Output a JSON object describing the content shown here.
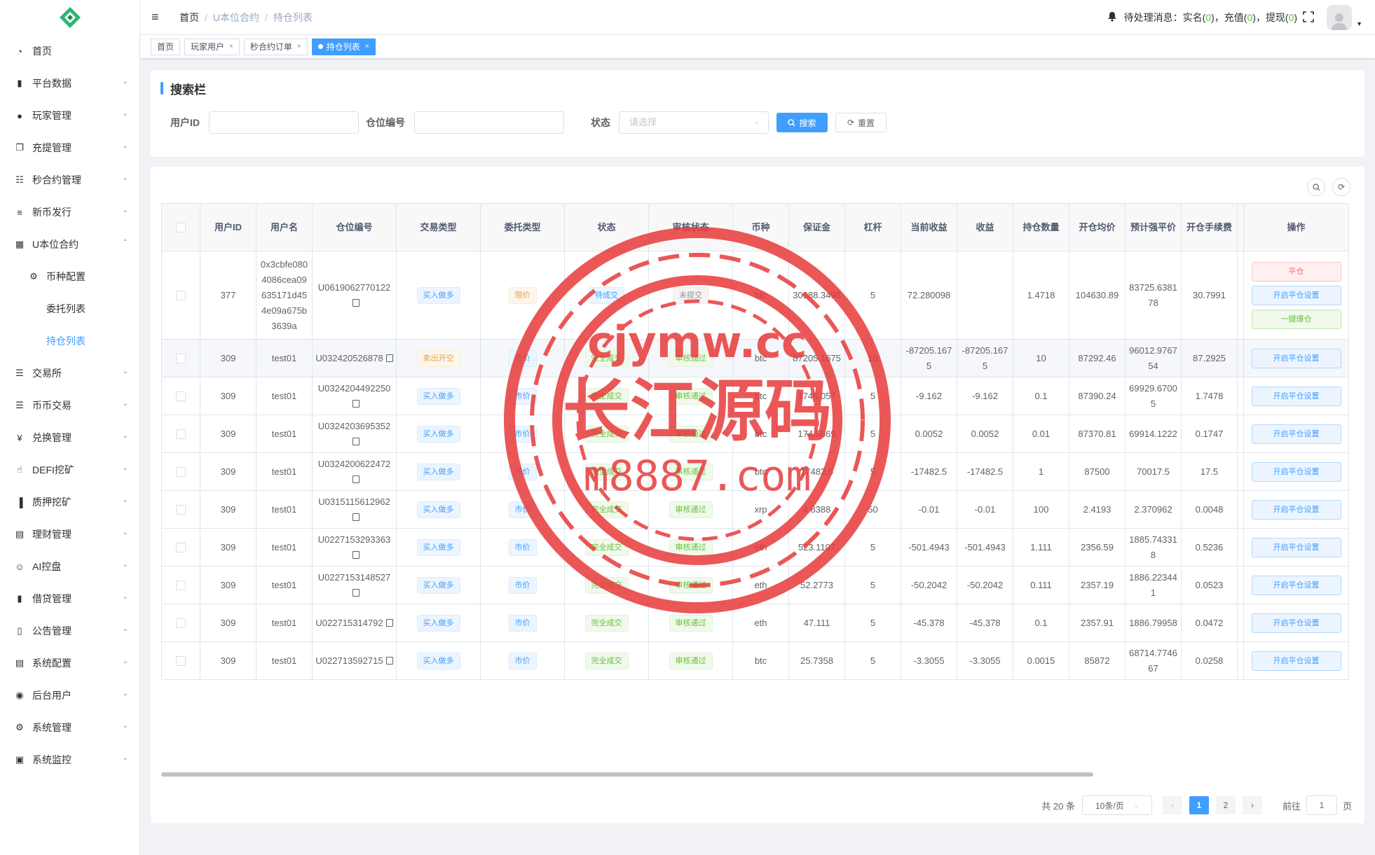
{
  "sidebar": {
    "items": [
      {
        "label": "首页",
        "icon": "dashboard-icon"
      },
      {
        "label": "平台数据",
        "icon": "book-icon",
        "arrow": "down"
      },
      {
        "label": "玩家管理",
        "icon": "user-icon",
        "arrow": "down"
      },
      {
        "label": "充提管理",
        "icon": "copy-icon",
        "arrow": "down"
      },
      {
        "label": "秒合约管理",
        "icon": "chart-icon",
        "arrow": "down"
      },
      {
        "label": "新币发行",
        "icon": "coin-icon",
        "arrow": "down"
      },
      {
        "label": "U本位合约",
        "icon": "grid-icon",
        "arrow": "up"
      },
      {
        "label": "币种配置",
        "icon": "gear-icon",
        "sub": true
      },
      {
        "label": "委托列表",
        "sub2": true
      },
      {
        "label": "持仓列表",
        "sub2": true,
        "active": true
      },
      {
        "label": "交易所",
        "icon": "list-icon",
        "arrow": "down"
      },
      {
        "label": "币币交易",
        "icon": "list-icon",
        "arrow": "down"
      },
      {
        "label": "兑换管理",
        "icon": "yen-icon",
        "arrow": "down"
      },
      {
        "label": "DEFI挖矿",
        "icon": "hand-icon",
        "arrow": "down"
      },
      {
        "label": "质押挖矿",
        "icon": "bar-chart-icon",
        "arrow": "down"
      },
      {
        "label": "理财管理",
        "icon": "document-icon",
        "arrow": "down"
      },
      {
        "label": "AI控盘",
        "icon": "robot-icon",
        "arrow": "down"
      },
      {
        "label": "借贷管理",
        "icon": "book-icon",
        "arrow": "down"
      },
      {
        "label": "公告管理",
        "icon": "open-book-icon",
        "arrow": "down"
      },
      {
        "label": "系统配置",
        "icon": "document-icon",
        "arrow": "down"
      },
      {
        "label": "后台用户",
        "icon": "users-icon",
        "arrow": "down"
      },
      {
        "label": "系统管理",
        "icon": "gear-icon",
        "arrow": "down"
      },
      {
        "label": "系统监控",
        "icon": "monitor-icon",
        "arrow": "down"
      }
    ]
  },
  "breadcrumb": {
    "home": "首页",
    "parent": "U本位合约",
    "current": "持仓列表"
  },
  "header": {
    "pending_label": "待处理消息：",
    "realname_label": "实名(",
    "realname_count": "0",
    "recharge_label": "充值(",
    "recharge_count": "0",
    "withdraw_label": "提现(",
    "withdraw_count": "0",
    "close": ")"
  },
  "tags": [
    {
      "label": "首页",
      "closable": false
    },
    {
      "label": "玩家用户",
      "closable": true
    },
    {
      "label": "秒合约订单",
      "closable": true
    },
    {
      "label": "持仓列表",
      "closable": true,
      "active": true
    }
  ],
  "search": {
    "title": "搜索栏",
    "user_id_label": "用户ID",
    "position_no_label": "仓位编号",
    "status_label": "状态",
    "status_placeholder": "请选择",
    "search_btn": "搜索",
    "reset_btn": "重置"
  },
  "table": {
    "headers": [
      "用户ID",
      "用户名",
      "仓位编号",
      "交易类型",
      "委托类型",
      "状态",
      "审核状态",
      "币种",
      "保证金",
      "杠杆",
      "当前收益",
      "收益",
      "持仓数量",
      "开仓均价",
      "预计强平价",
      "开仓手续费",
      "操作"
    ],
    "rows": [
      {
        "uid": "377",
        "name": "0x3cbfe0804086cea09635171d454e09a675b3639a",
        "pos": "U0619062770122",
        "trade": "买入做多",
        "trade_c": "t-blue",
        "order": "限价",
        "order_c": "t-orange",
        "status": "待成交",
        "status_c": "t-blue",
        "audit": "未提交",
        "audit_c": "t-grey",
        "coin": "btc",
        "margin": "30988.3496",
        "lev": "5",
        "cur": "72.280098",
        "profit": "",
        "qty": "1.4718",
        "avg": "104630.89",
        "liq": "83725.638178",
        "fee": "30.7991",
        "ops": [
          {
            "label": "平仓",
            "c": "ob-red"
          },
          {
            "label": "开启平仓设置",
            "c": "ob-blue"
          },
          {
            "label": "一键爆仓",
            "c": "ob-green"
          }
        ]
      },
      {
        "uid": "309",
        "name": "test01",
        "pos": "U032420526878",
        "trade": "卖出开空",
        "trade_c": "t-orange",
        "order": "市价",
        "order_c": "t-blue",
        "status": "完全成交",
        "status_c": "t-green",
        "audit": "审核通过",
        "audit_c": "t-green",
        "coin": "btc",
        "margin": "87205.1675",
        "lev": "10",
        "cur": "-87205.1675",
        "profit": "-87205.1675",
        "qty": "10",
        "avg": "87292.46",
        "liq": "96012.976754",
        "fee": "87.2925",
        "hl": true,
        "ops": [
          {
            "label": "开启平仓设置",
            "c": "ob-blue"
          }
        ]
      },
      {
        "uid": "309",
        "name": "test01",
        "pos": "U0324204492250",
        "trade": "买入做多",
        "trade_c": "t-blue",
        "order": "市价",
        "order_c": "t-blue",
        "status": "完全成交",
        "status_c": "t-green",
        "audit": "审核通过",
        "audit_c": "t-green",
        "coin": "btc",
        "margin": "1746.057",
        "lev": "5",
        "cur": "-9.162",
        "profit": "-9.162",
        "qty": "0.1",
        "avg": "87390.24",
        "liq": "69929.67005",
        "fee": "1.7478",
        "ops": [
          {
            "label": "开启平仓设置",
            "c": "ob-blue"
          }
        ]
      },
      {
        "uid": "309",
        "name": "test01",
        "pos": "U0324203695352",
        "trade": "买入做多",
        "trade_c": "t-blue",
        "order": "市价",
        "order_c": "t-blue",
        "status": "完全成交",
        "status_c": "t-green",
        "audit": "审核通过",
        "audit_c": "t-green",
        "coin": "btc",
        "margin": "174.5669",
        "lev": "5",
        "cur": "0.0052",
        "profit": "0.0052",
        "qty": "0.01",
        "avg": "87370.81",
        "liq": "69914.1222",
        "fee": "0.1747",
        "ops": [
          {
            "label": "开启平仓设置",
            "c": "ob-blue"
          }
        ]
      },
      {
        "uid": "309",
        "name": "test01",
        "pos": "U0324200622472",
        "trade": "买入做多",
        "trade_c": "t-blue",
        "order": "市价",
        "order_c": "t-blue",
        "status": "完全成交",
        "status_c": "t-green",
        "audit": "审核通过",
        "audit_c": "t-green",
        "coin": "btc",
        "margin": "17482.5",
        "lev": "5",
        "cur": "-17482.5",
        "profit": "-17482.5",
        "qty": "1",
        "avg": "87500",
        "liq": "70017.5",
        "fee": "17.5",
        "ops": [
          {
            "label": "开启平仓设置",
            "c": "ob-blue"
          }
        ]
      },
      {
        "uid": "309",
        "name": "test01",
        "pos": "U0315115612962",
        "trade": "买入做多",
        "trade_c": "t-blue",
        "order": "市价",
        "order_c": "t-blue",
        "status": "完全成交",
        "status_c": "t-green",
        "audit": "审核通过",
        "audit_c": "t-green",
        "coin": "xrp",
        "margin": "4.8388",
        "lev": "50",
        "cur": "-0.01",
        "profit": "-0.01",
        "qty": "100",
        "avg": "2.4193",
        "liq": "2.370962",
        "fee": "0.0048",
        "ops": [
          {
            "label": "开启平仓设置",
            "c": "ob-blue"
          }
        ]
      },
      {
        "uid": "309",
        "name": "test01",
        "pos": "U0227153293363",
        "trade": "买入做多",
        "trade_c": "t-blue",
        "order": "市价",
        "order_c": "t-blue",
        "status": "完全成交",
        "status_c": "t-green",
        "audit": "审核通过",
        "audit_c": "t-green",
        "coin": "eth",
        "margin": "523.1107",
        "lev": "5",
        "cur": "-501.4943",
        "profit": "-501.4943",
        "qty": "1.111",
        "avg": "2356.59",
        "liq": "1885.743318",
        "fee": "0.5236",
        "ops": [
          {
            "label": "开启平仓设置",
            "c": "ob-blue"
          }
        ]
      },
      {
        "uid": "309",
        "name": "test01",
        "pos": "U0227153148527",
        "trade": "买入做多",
        "trade_c": "t-blue",
        "order": "市价",
        "order_c": "t-blue",
        "status": "完全成交",
        "status_c": "t-green",
        "audit": "审核通过",
        "audit_c": "t-green",
        "coin": "eth",
        "margin": "52.2773",
        "lev": "5",
        "cur": "-50.2042",
        "profit": "-50.2042",
        "qty": "0.111",
        "avg": "2357.19",
        "liq": "1886.223441",
        "fee": "0.0523",
        "ops": [
          {
            "label": "开启平仓设置",
            "c": "ob-blue"
          }
        ]
      },
      {
        "uid": "309",
        "name": "test01",
        "pos": "U022715314792",
        "trade": "买入做多",
        "trade_c": "t-blue",
        "order": "市价",
        "order_c": "t-blue",
        "status": "完全成交",
        "status_c": "t-green",
        "audit": "审核通过",
        "audit_c": "t-green",
        "coin": "eth",
        "margin": "47.111",
        "lev": "5",
        "cur": "-45.378",
        "profit": "-45.378",
        "qty": "0.1",
        "avg": "2357.91",
        "liq": "1886.79958",
        "fee": "0.0472",
        "ops": [
          {
            "label": "开启平仓设置",
            "c": "ob-blue"
          }
        ]
      },
      {
        "uid": "309",
        "name": "test01",
        "pos": "U022713592715",
        "trade": "买入做多",
        "trade_c": "t-blue",
        "order": "市价",
        "order_c": "t-blue",
        "status": "完全成交",
        "status_c": "t-green",
        "audit": "审核通过",
        "audit_c": "t-green",
        "coin": "btc",
        "margin": "25.7358",
        "lev": "5",
        "cur": "-3.3055",
        "profit": "-3.3055",
        "qty": "0.0015",
        "avg": "85872",
        "liq": "68714.774667",
        "fee": "0.0258",
        "ops": [
          {
            "label": "开启平仓设置",
            "c": "ob-blue"
          }
        ]
      }
    ]
  },
  "pagination": {
    "total": "共 20 条",
    "page_size": "10条/页",
    "pages": [
      "1",
      "2"
    ],
    "current": "1",
    "goto_label": "前往",
    "goto_value": "1",
    "page_unit": "页"
  },
  "watermark": {
    "line1": "cjymw.cc",
    "line2": "长江源码",
    "line3": "m8887.com"
  }
}
